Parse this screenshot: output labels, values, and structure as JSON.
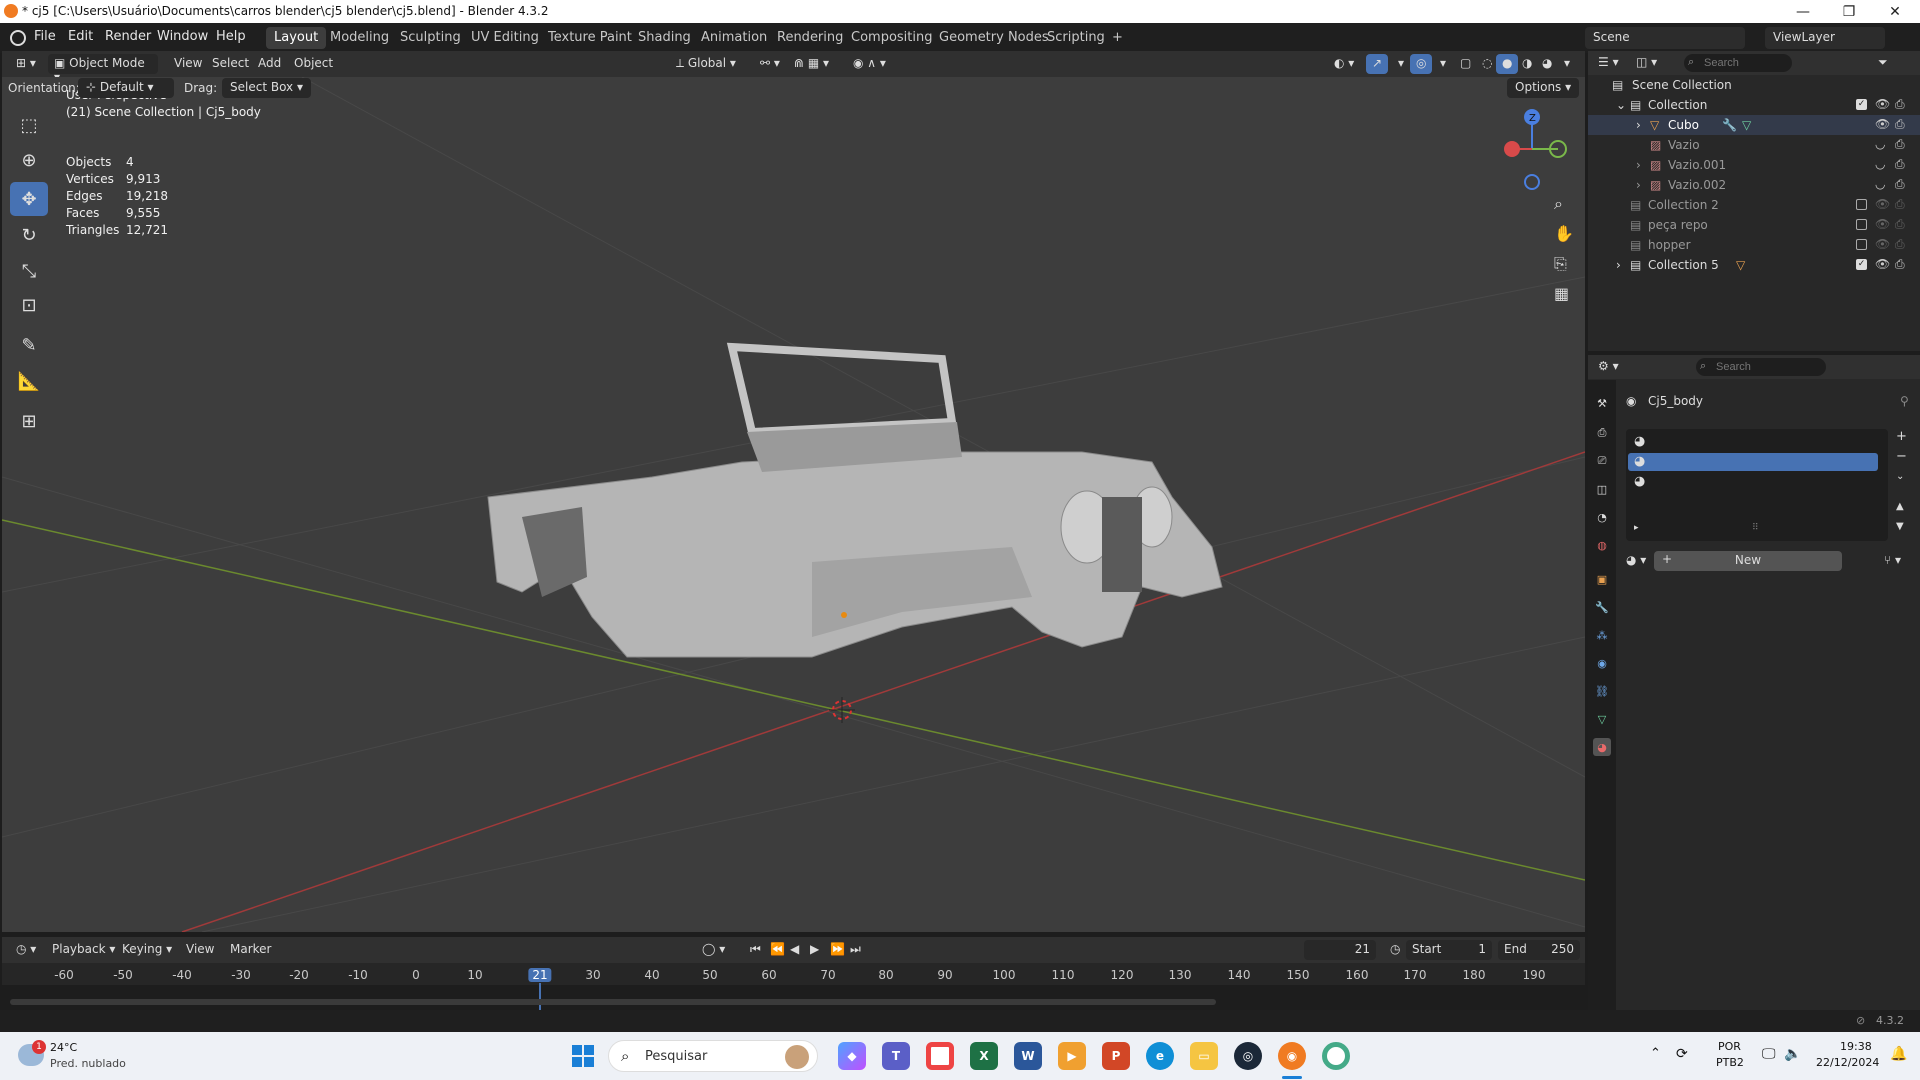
{
  "window": {
    "title": "* cj5 [C:\\Users\\Usuário\\Documents\\carros blender\\cj5 blender\\cj5.blend] - Blender 4.3.2",
    "minimize": "—",
    "maximize": "❐",
    "close": "✕"
  },
  "menu": [
    "File",
    "Edit",
    "Render",
    "Window",
    "Help"
  ],
  "workspaces": [
    "Layout",
    "Modeling",
    "Sculpting",
    "UV Editing",
    "Texture Paint",
    "Shading",
    "Animation",
    "Rendering",
    "Compositing",
    "Geometry Nodes",
    "Scripting"
  ],
  "active_workspace": "Layout",
  "add_workspace": "+",
  "scene": {
    "label": "Scene",
    "view_layer": "ViewLayer"
  },
  "viewport_header": {
    "mode": "Object Mode",
    "menus": [
      "View",
      "Select",
      "Add",
      "Object"
    ],
    "transform_orientation": "Global",
    "orientation_label": "Orientation:",
    "orientation_value": "Default",
    "drag_label": "Drag:",
    "drag_value": "Select Box",
    "options": "Options"
  },
  "viewport": {
    "perspective": "User Perspective",
    "context": "(21) Scene Collection | Cj5_body",
    "stats": [
      {
        "label": "Objects",
        "value": "4"
      },
      {
        "label": "Vertices",
        "value": "9,913"
      },
      {
        "label": "Edges",
        "value": "19,218"
      },
      {
        "label": "Faces",
        "value": "9,555"
      },
      {
        "label": "Triangles",
        "value": "12,721"
      }
    ],
    "gizmo_z": "Z"
  },
  "outliner": {
    "search_placeholder": "Search",
    "root": "Scene Collection",
    "rows": [
      {
        "name": "Collection",
        "level": 1,
        "expanded": true
      },
      {
        "name": "Cubo",
        "level": 2,
        "selected": true
      },
      {
        "name": "Vazio",
        "level": 2
      },
      {
        "name": "Vazio.001",
        "level": 2
      },
      {
        "name": "Vazio.002",
        "level": 2
      },
      {
        "name": "Collection 2",
        "level": 1
      },
      {
        "name": "peça repo",
        "level": 1
      },
      {
        "name": "hopper",
        "level": 1
      },
      {
        "name": "Collection 5",
        "level": 1
      }
    ]
  },
  "properties": {
    "search_placeholder": "Search",
    "object_name": "Cj5_body",
    "new_button": "New",
    "plus": "+"
  },
  "timeline": {
    "menus": [
      "Playback",
      "Keying",
      "View",
      "Marker"
    ],
    "current_frame": "21",
    "start_label": "Start",
    "start_value": "1",
    "end_label": "End",
    "end_value": "250",
    "ticks": [
      "-60",
      "-50",
      "-40",
      "-30",
      "-20",
      "-10",
      "0",
      "10",
      "21",
      "30",
      "40",
      "50",
      "60",
      "70",
      "80",
      "90",
      "100",
      "110",
      "120",
      "130",
      "140",
      "150",
      "160",
      "170",
      "180",
      "190"
    ]
  },
  "status": {
    "version": "4.3.2"
  },
  "taskbar": {
    "weather_temp": "24°C",
    "weather_desc": "Pred. nublado",
    "badge": "1",
    "search_placeholder": "Pesquisar",
    "lang": "POR",
    "layout": "PTB2",
    "time": "19:38",
    "date": "22/12/2024"
  }
}
